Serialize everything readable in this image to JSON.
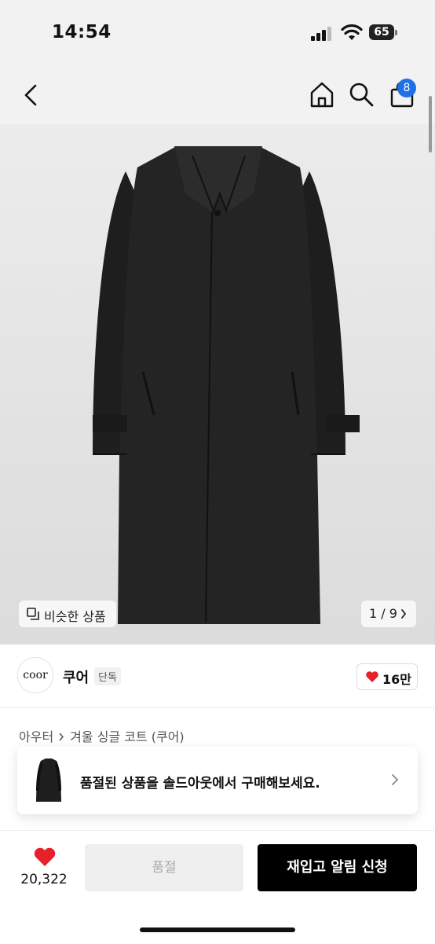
{
  "status": {
    "time": "14:54",
    "battery": "65"
  },
  "nav": {
    "cart_count": "8"
  },
  "gallery": {
    "similar_label": "비슷한 상품",
    "pager": "1 / 9"
  },
  "brand": {
    "logo_text": "coor",
    "name": "쿠어",
    "tag": "단독",
    "likes": "16만"
  },
  "breadcrumb": {
    "category": "아우터",
    "product": "겨울 싱글 코트 (쿠어)"
  },
  "banner": {
    "text": "품절된 상품을 솔드아웃에서 구매해보세요."
  },
  "bottom": {
    "wish_count": "20,322",
    "soldout_label": "품절",
    "restock_label": "재입고 알림 신청"
  },
  "colors": {
    "accent": "#1f6fe5",
    "heart": "#e8202a",
    "primary_button": "#000000"
  }
}
